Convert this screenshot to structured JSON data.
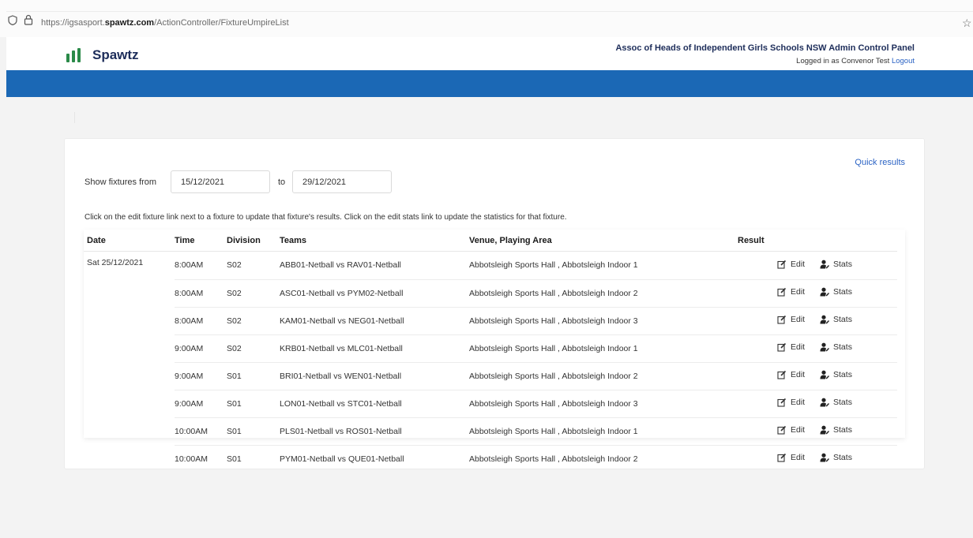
{
  "browser": {
    "url_prefix": "https://igsasport.",
    "url_domain": "spawtz.com",
    "url_path": "/ActionController/FixtureUmpireList",
    "star_icon": "star-icon"
  },
  "header": {
    "logo_text": "Spawtz",
    "org_title": "Assoc of Heads of Independent Girls Schools NSW Admin Control Panel",
    "login_text": "Logged in as Convenor Test",
    "logout_label": "Logout",
    "brand_color": "#1b68b5",
    "logo_color": "#2a8a48"
  },
  "filter": {
    "quick_results_label": "Quick results",
    "show_from_label": "Show fixtures from",
    "from_value": "15/12/2021",
    "to_label": "to",
    "to_value": "29/12/2021",
    "instructions": "Click on the edit fixture link next to a fixture to update that fixture's results. Click on the edit stats link to update the statistics for that fixture."
  },
  "table": {
    "columns": [
      "Date",
      "Time",
      "Division",
      "Teams",
      "Venue, Playing Area",
      "Result"
    ],
    "date": "Sat 25/12/2021",
    "edit_label": "Edit",
    "stats_label": "Stats",
    "rows": [
      {
        "time": "8:00AM",
        "division": "S02",
        "teams": "ABB01-Netball vs RAV01-Netball",
        "venue": "Abbotsleigh Sports Hall , Abbotsleigh Indoor 1"
      },
      {
        "time": "8:00AM",
        "division": "S02",
        "teams": "ASC01-Netball vs PYM02-Netball",
        "venue": "Abbotsleigh Sports Hall , Abbotsleigh Indoor 2"
      },
      {
        "time": "8:00AM",
        "division": "S02",
        "teams": "KAM01-Netball vs NEG01-Netball",
        "venue": "Abbotsleigh Sports Hall , Abbotsleigh Indoor 3"
      },
      {
        "time": "9:00AM",
        "division": "S02",
        "teams": "KRB01-Netball vs MLC01-Netball",
        "venue": "Abbotsleigh Sports Hall , Abbotsleigh Indoor 1"
      },
      {
        "time": "9:00AM",
        "division": "S01",
        "teams": "BRI01-Netball vs WEN01-Netball",
        "venue": "Abbotsleigh Sports Hall , Abbotsleigh Indoor 2"
      },
      {
        "time": "9:00AM",
        "division": "S01",
        "teams": "LON01-Netball vs STC01-Netball",
        "venue": "Abbotsleigh Sports Hall , Abbotsleigh Indoor 3"
      },
      {
        "time": "10:00AM",
        "division": "S01",
        "teams": "PLS01-Netball vs ROS01-Netball",
        "venue": "Abbotsleigh Sports Hall , Abbotsleigh Indoor 1"
      },
      {
        "time": "10:00AM",
        "division": "S01",
        "teams": "PYM01-Netball vs QUE01-Netball",
        "venue": "Abbotsleigh Sports Hall , Abbotsleigh Indoor 2"
      }
    ]
  }
}
